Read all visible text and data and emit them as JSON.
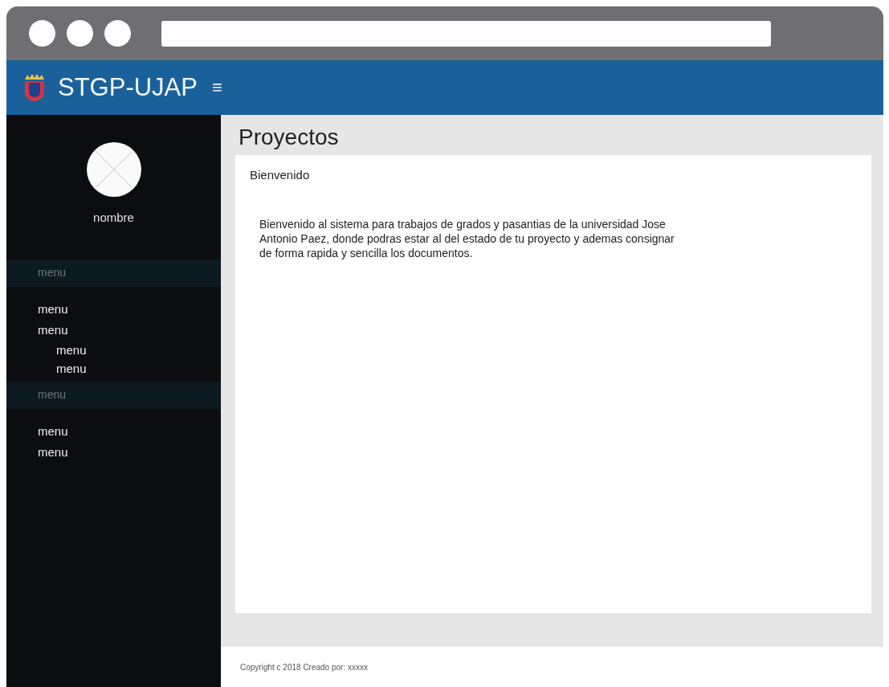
{
  "header": {
    "brand": "STGP-UJAP",
    "menu_glyph": "≡"
  },
  "sidebar": {
    "user_name": "nombre",
    "items": [
      {
        "kind": "header",
        "label": "menu"
      },
      {
        "kind": "item",
        "label": "menu"
      },
      {
        "kind": "item",
        "label": "menu",
        "children": [
          {
            "kind": "item",
            "label": "menu"
          },
          {
            "kind": "item",
            "label": "menu"
          }
        ]
      },
      {
        "kind": "header",
        "label": "menu"
      },
      {
        "kind": "item",
        "label": "menu"
      },
      {
        "kind": "item",
        "label": "menu"
      }
    ]
  },
  "main": {
    "title": "Proyectos",
    "card": {
      "heading": "Bienvenido",
      "body": "Bienvenido al sistema para trabajos de grados y pasantias de la universidad Jose Antonio Paez, donde podras estar al del estado de tu proyecto y ademas consignar de forma rapida y sencilla los documentos."
    }
  },
  "footer": {
    "text": "Copyright c 2018 Creado por: xxxxx"
  }
}
